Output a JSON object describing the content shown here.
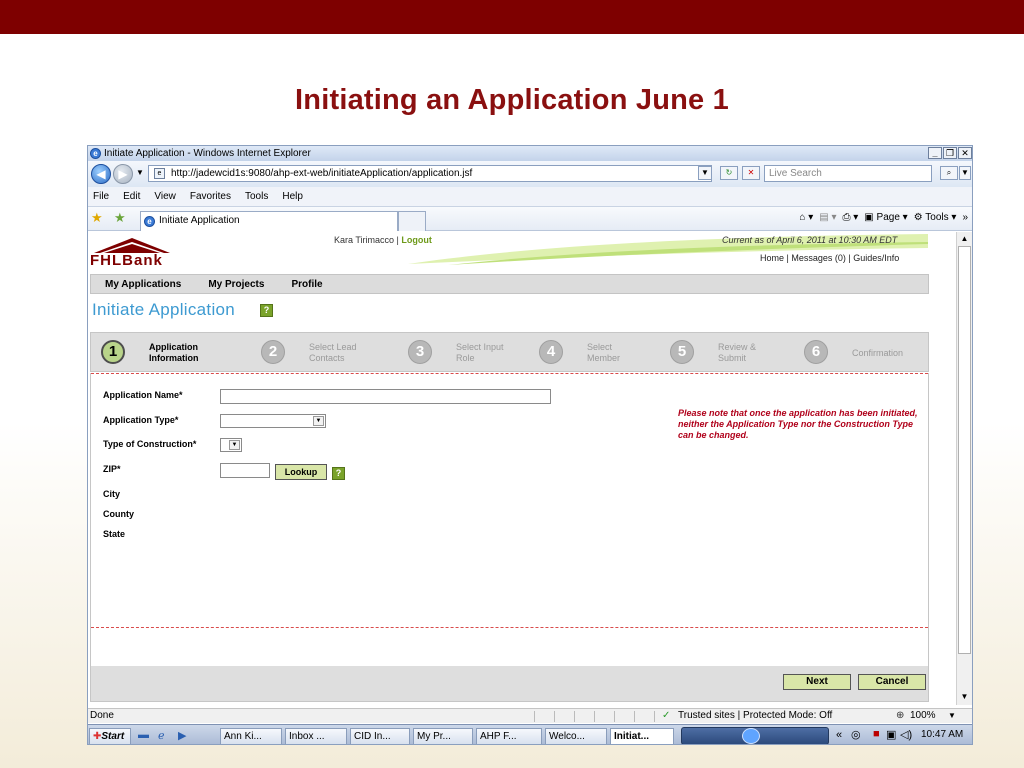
{
  "slide": {
    "title": "Initiating an Application June 1"
  },
  "window": {
    "title": "Initiate Application - Windows Internet Explorer"
  },
  "addressbar": {
    "url": "http://jadewcid1s:9080/ahp-ext-web/initiateApplication/application.jsf",
    "search_placeholder": "Live Search"
  },
  "menu": [
    "File",
    "Edit",
    "View",
    "Favorites",
    "Tools",
    "Help"
  ],
  "tab": {
    "label": "Initiate Application"
  },
  "toolbar_right": {
    "page": "Page",
    "tools": "Tools"
  },
  "header": {
    "logo": "FHLBank",
    "user": "Kara Tirimacco |",
    "logout": "Logout",
    "current_as": "Current as of April 6, 2011 at 10:30 AM EDT",
    "links": "Home | Messages (0) | Guides/Info"
  },
  "app_nav": [
    "My Applications",
    "My Projects",
    "Profile"
  ],
  "page_heading": "Initiate Application",
  "steps": [
    {
      "num": "1",
      "label": "Application Information"
    },
    {
      "num": "2",
      "label": "Select Lead Contacts"
    },
    {
      "num": "3",
      "label": "Select Input Role"
    },
    {
      "num": "4",
      "label": "Select Member"
    },
    {
      "num": "5",
      "label": "Review & Submit"
    },
    {
      "num": "6",
      "label": "Confirmation"
    }
  ],
  "form": {
    "app_name_label": "Application Name*",
    "app_type_label": "Application Type*",
    "construction_label": "Type of Construction*",
    "zip_label": "ZIP*",
    "lookup": "Lookup",
    "city_label": "City",
    "county_label": "County",
    "state_label": "State",
    "note": "Please note that once the application has been initiated, neither the Application Type nor the Construction Type can be changed."
  },
  "buttons": {
    "next": "Next",
    "cancel": "Cancel"
  },
  "status": {
    "left": "Done",
    "zone": "Trusted sites | Protected Mode: Off",
    "zoom": "100%"
  },
  "taskbar": {
    "start": "Start",
    "items": [
      "Ann Ki...",
      "Inbox ...",
      "CID In...",
      "My Pr...",
      "AHP F...",
      "Welco...",
      "Initiat..."
    ],
    "time": "10:47 AM"
  }
}
